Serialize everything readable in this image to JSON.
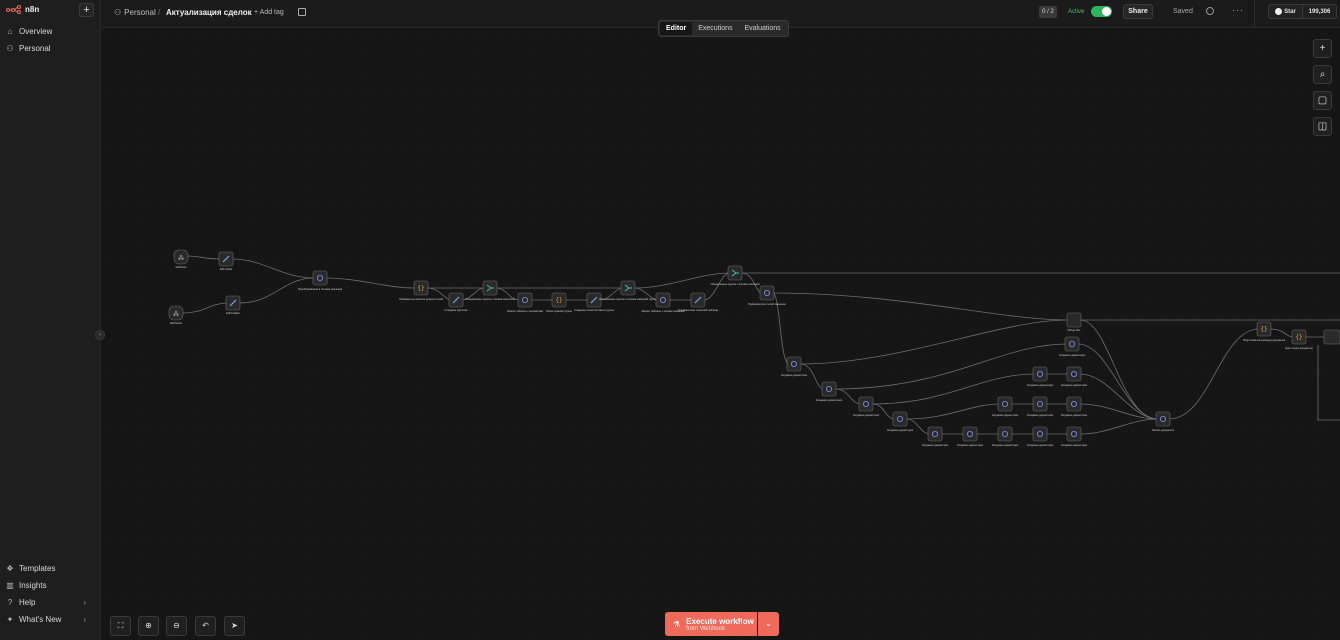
{
  "app": {
    "logo_text": "n8n",
    "new_label": "+"
  },
  "sidebar": {
    "top_items": [
      {
        "label": "Overview",
        "icon": "home-icon"
      },
      {
        "label": "Personal",
        "icon": "user-icon"
      }
    ],
    "bottom_items": [
      {
        "label": "Templates",
        "icon": "templates-icon"
      },
      {
        "label": "Insights",
        "icon": "chart-icon"
      },
      {
        "label": "Help",
        "icon": "help-icon"
      },
      {
        "label": "What's New",
        "icon": "bell-icon"
      }
    ]
  },
  "header": {
    "project": "Personal",
    "separator": "/",
    "workflow_title": "Актуализация сделок",
    "add_tag": "+ Add tag",
    "counter": "0 / 2",
    "active_label": "Active",
    "share_label": "Share",
    "saved_label": "Saved",
    "more_label": "···",
    "github_star": "Star",
    "github_count": "199,306"
  },
  "tabs": [
    {
      "label": "Editor",
      "active": true
    },
    {
      "label": "Executions",
      "active": false
    },
    {
      "label": "Evaluations",
      "active": false
    }
  ],
  "toolbar": {
    "execute_label": "Execute workflow",
    "execute_sub": "from Webhook"
  },
  "nodes": [
    {
      "label": "Webhook",
      "sub": ""
    },
    {
      "label": "Edit Fields",
      "sub": "manual"
    },
    {
      "label": "Webhook1",
      "sub": ""
    },
    {
      "label": "Edit Fields1",
      "sub": "manual"
    },
    {
      "label": "Преобразование в готовые значения",
      "sub": "GET: https://..."
    },
    {
      "label": "Проверка на наличие нужных полей",
      "sub": ""
    },
    {
      "label": "Создание карточки",
      "sub": ""
    },
    {
      "label": "Объединение сделок с полями контактов",
      "sub": ""
    },
    {
      "label": "Запрос таблицы с контактами",
      "sub": ""
    },
    {
      "label": "Поиск нужной группы",
      "sub": ""
    },
    {
      "label": "Создание полей контакта группы",
      "sub": ""
    },
    {
      "label": "Объединение сделок с полями значений группы",
      "sub": ""
    },
    {
      "label": "Запрос таблицы с полями значений",
      "sub": ""
    },
    {
      "label": "Создание всех значений таблицы",
      "sub": ""
    },
    {
      "label": "Объединение сделок с полями значений",
      "sub": ""
    },
    {
      "label": "Проверка всех полей значения",
      "sub": ""
    },
    {
      "label": "Создание директории",
      "sub": ""
    },
    {
      "label": "Merge Doc",
      "sub": ""
    },
    {
      "label": "Запись документа",
      "sub": ""
    },
    {
      "label": "Подготовка на проверку документа",
      "sub": ""
    },
    {
      "label": "Цикл через документы",
      "sub": ""
    }
  ]
}
